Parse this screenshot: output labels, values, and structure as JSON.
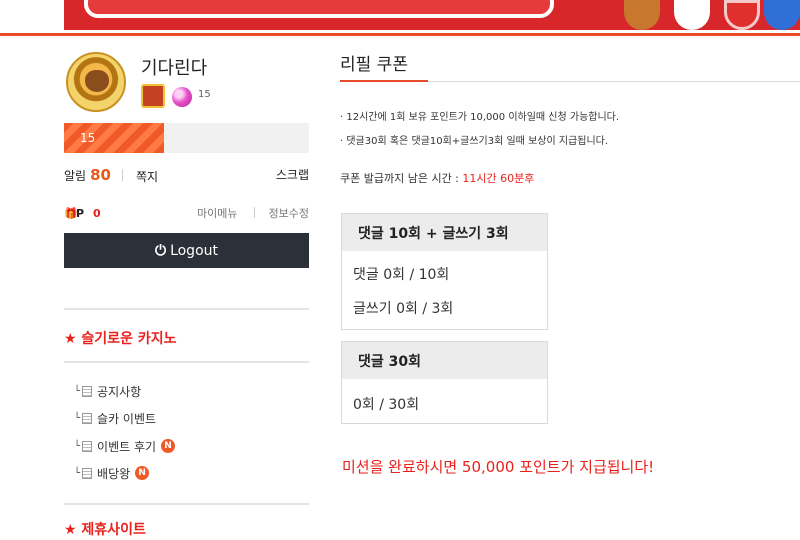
{
  "header": {
    "brand_color": "#d8272a",
    "accent_line_color": "#e84a2a"
  },
  "profile": {
    "nickname": "기다린다",
    "level": "15",
    "level_progress": 0.41,
    "alarm_label": "알림",
    "alarm_count": "80",
    "memo_label": "쪽지",
    "scrap_label": "스크랩",
    "gift_icon": "gift-icon",
    "point_label": "P",
    "point_value": "0",
    "mymenu_label": "마이메뉴",
    "editinfo_label": "정보수정",
    "logout_label": "Logout",
    "logout_icon": "power-icon"
  },
  "sidebar": {
    "section1_title": "★ 슬기로운 카지노",
    "items": [
      {
        "label": "공지사항",
        "new": false
      },
      {
        "label": "슬카 이벤트",
        "new": false
      },
      {
        "label": "이벤트 후기",
        "new": true
      },
      {
        "label": "배당왕",
        "new": true
      }
    ],
    "new_badge": "N",
    "section2_title": "★ 제휴사이트"
  },
  "main": {
    "title": "리필 쿠폰",
    "rules": [
      "· 12시간에 1회 보유 포인트가 10,000 이하일때 신청 가능합니다.",
      "· 댓글30회 혹은 댓글10회+글쓰기3회 일때 보상이 지급됩니다."
    ],
    "timer_label": "쿠폰 발급까지 남은 시간 :",
    "timer_value": "11시간 60분후",
    "box1": {
      "title": "댓글 10회 + 글쓰기 3회",
      "line1": "댓글 0회 / 10회",
      "line2": "글쓰기 0회 / 3회"
    },
    "box2": {
      "title": "댓글 30회",
      "line1": "0회 / 30회"
    },
    "completion_message": "미션을 완료하시면 50,000 포인트가 지급됩니다!"
  }
}
